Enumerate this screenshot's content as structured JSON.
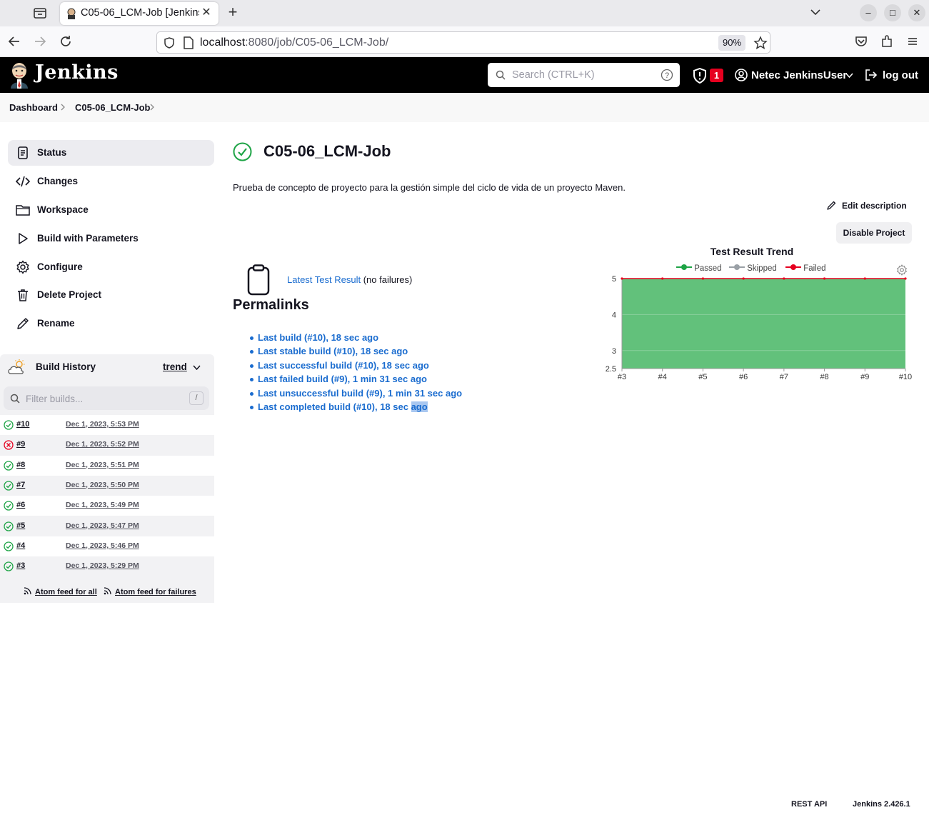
{
  "browser": {
    "tab_title": "C05-06_LCM-Job [Jenkins]",
    "url_host": "localhost",
    "url_rest": ":8080/job/C05-06_LCM-Job/",
    "zoom": "90%"
  },
  "header": {
    "brand": "Jenkins",
    "search_placeholder": "Search (CTRL+K)",
    "security_count": "1",
    "user_name": "Netec JenkinsUser",
    "logout_label": "log out"
  },
  "breadcrumb": [
    "Dashboard",
    "C05-06_LCM-Job"
  ],
  "sidebar": {
    "items": [
      {
        "label": "Status",
        "icon": "document-icon",
        "active": true
      },
      {
        "label": "Changes",
        "icon": "code-icon"
      },
      {
        "label": "Workspace",
        "icon": "folder-icon"
      },
      {
        "label": "Build with Parameters",
        "icon": "play-icon"
      },
      {
        "label": "Configure",
        "icon": "gear-icon"
      },
      {
        "label": "Delete Project",
        "icon": "trash-icon"
      },
      {
        "label": "Rename",
        "icon": "pencil-icon"
      }
    ]
  },
  "build_history": {
    "title": "Build History",
    "trend_label": "trend",
    "filter_placeholder": "Filter builds...",
    "filter_shortcut": "/",
    "builds": [
      {
        "num": "#10",
        "date": "Dec 1, 2023, 5:53 PM",
        "status": "success"
      },
      {
        "num": "#9",
        "date": "Dec 1, 2023, 5:52 PM",
        "status": "failed"
      },
      {
        "num": "#8",
        "date": "Dec 1, 2023, 5:51 PM",
        "status": "success"
      },
      {
        "num": "#7",
        "date": "Dec 1, 2023, 5:50 PM",
        "status": "success"
      },
      {
        "num": "#6",
        "date": "Dec 1, 2023, 5:49 PM",
        "status": "success"
      },
      {
        "num": "#5",
        "date": "Dec 1, 2023, 5:47 PM",
        "status": "success"
      },
      {
        "num": "#4",
        "date": "Dec 1, 2023, 5:46 PM",
        "status": "success"
      },
      {
        "num": "#3",
        "date": "Dec 1, 2023, 5:29 PM",
        "status": "success"
      }
    ],
    "feed_all": "Atom feed for all",
    "feed_failures": "Atom feed for failures"
  },
  "main": {
    "job_title": "C05-06_LCM-Job",
    "description": "Prueba de concepto de proyecto para la gestión simple del ciclo de vida de un proyecto Maven.",
    "edit_description": "Edit description",
    "disable_project": "Disable Project",
    "latest_test_result": "Latest Test Result",
    "no_failures": "(no failures)",
    "permalinks_title": "Permalinks",
    "permalinks": [
      "Last build (#10), 18 sec ago",
      "Last stable build (#10), 18 sec ago",
      "Last successful build (#10), 18 sec ago",
      "Last failed build (#9), 1 min 31 sec ago",
      "Last unsuccessful build (#9), 1 min 31 sec ago",
      "Last completed build (#10), 18 sec "
    ],
    "permalink_highlight": "ago"
  },
  "chart_data": {
    "type": "area",
    "title": "Test Result Trend",
    "categories": [
      "#3",
      "#4",
      "#5",
      "#6",
      "#7",
      "#8",
      "#9",
      "#10"
    ],
    "series": [
      {
        "name": "Passed",
        "values": [
          5,
          5,
          5,
          5,
          5,
          5,
          5,
          5
        ],
        "color": "#1ea446"
      },
      {
        "name": "Skipped",
        "values": [
          0,
          0,
          0,
          0,
          0,
          0,
          0,
          0
        ],
        "color": "#9aa0a6"
      },
      {
        "name": "Failed",
        "values": [
          0,
          0,
          0,
          0,
          0,
          0,
          0,
          0
        ],
        "color": "#e6001f"
      }
    ],
    "yticks": [
      "5",
      "4",
      "3",
      "2.5"
    ],
    "ylim": [
      2.5,
      5
    ],
    "fill_color": "#62c17b",
    "legend_position": "top"
  },
  "footer": {
    "rest_api": "REST API",
    "version": "Jenkins 2.426.1"
  },
  "colors": {
    "link": "#1a6ccf",
    "success": "#1ea446",
    "failure": "#e6001f"
  }
}
